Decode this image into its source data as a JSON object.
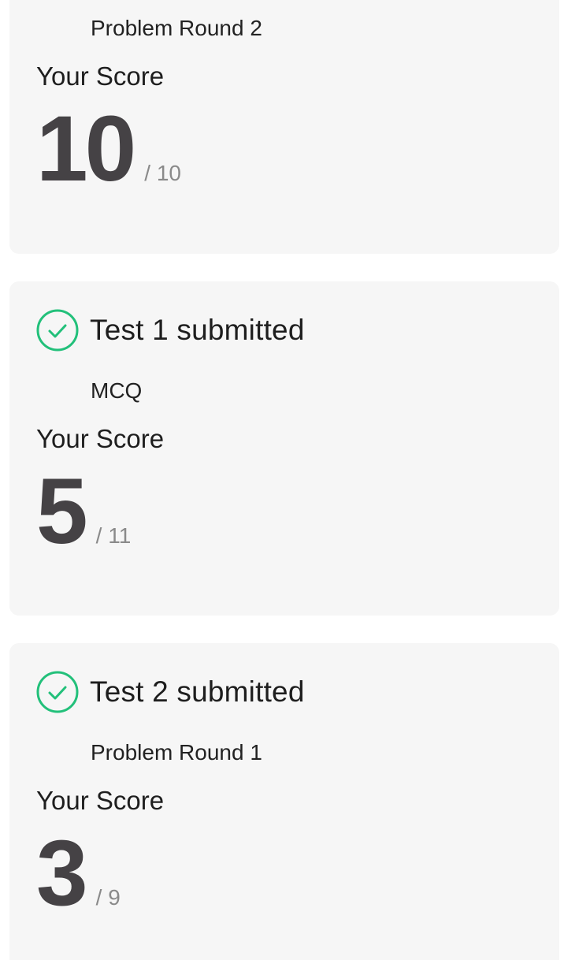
{
  "accent_color": "#22c07a",
  "cards": [
    {
      "round_name": "Problem Round 2",
      "score_label": "Your Score",
      "score": "10",
      "total": "/ 10"
    },
    {
      "status": "Test 1 submitted",
      "status_icon": "check-circle-icon",
      "round_name": "MCQ",
      "score_label": "Your Score",
      "score": "5",
      "total": "/ 11"
    },
    {
      "status": "Test 2 submitted",
      "status_icon": "check-circle-icon",
      "round_name": "Problem Round 1",
      "score_label": "Your Score",
      "score": "3",
      "total": "/ 9"
    }
  ]
}
